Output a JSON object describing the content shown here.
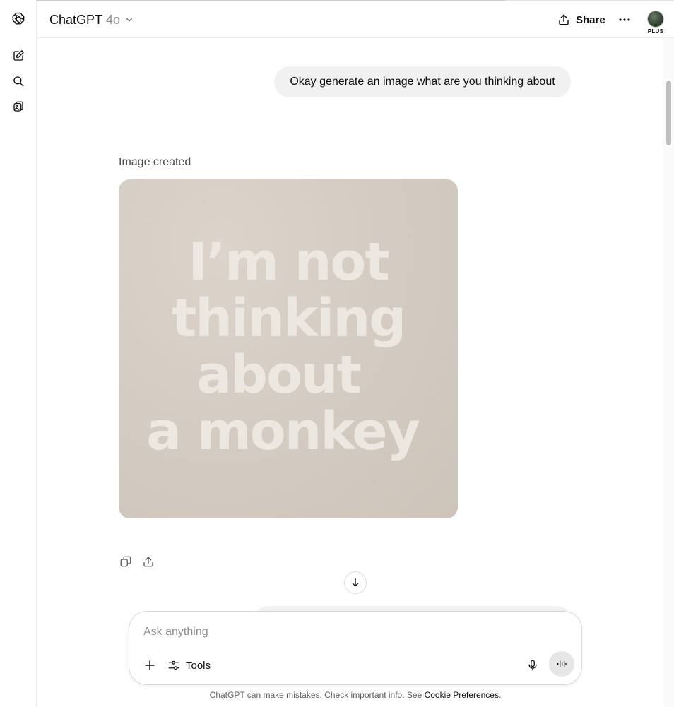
{
  "header": {
    "model_name": "ChatGPT",
    "model_version": "4o",
    "share_label": "Share",
    "plan_badge": "PLUS"
  },
  "sidebar": {
    "items": [
      {
        "icon": "openai-logo-icon"
      },
      {
        "icon": "new-chat-icon"
      },
      {
        "icon": "search-icon"
      },
      {
        "icon": "library-icon"
      }
    ]
  },
  "conversation": {
    "user_message": "Okay generate an image what are you thinking about",
    "image_caption": "Image created",
    "image_text": [
      "I’m not",
      "thinking",
      "about",
      "a monkey"
    ],
    "image_colors": {
      "background": "#d3cbc1",
      "text": "#ece7e1"
    }
  },
  "composer": {
    "placeholder": "Ask anything",
    "tools_label": "Tools"
  },
  "footer": {
    "disclaimer": "ChatGPT can make mistakes. Check important info. See",
    "link_text": "Cookie Preferences",
    "end": "."
  }
}
